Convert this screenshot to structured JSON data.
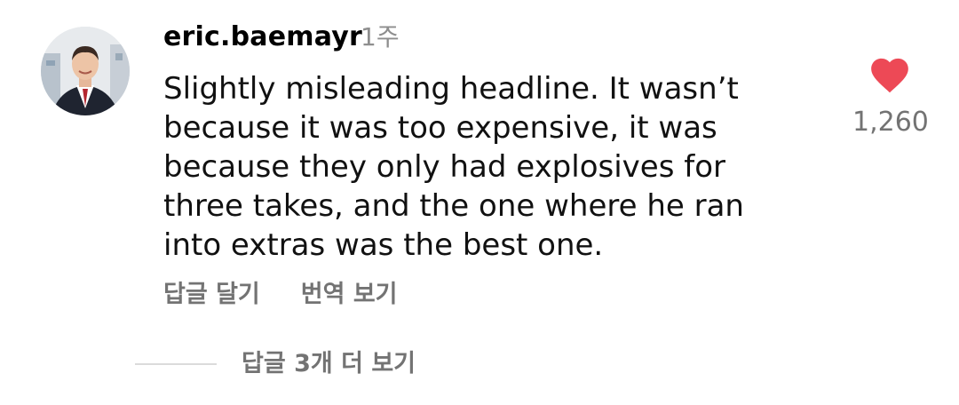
{
  "comment": {
    "username": "eric.baemayr",
    "time": "1주",
    "text_lines": [
      "Slightly misleading headline. It wasn’t",
      "because it was too expensive, it was",
      "because they only had explosives for",
      "three takes, and the one where he ran",
      "into extras was the best one."
    ],
    "actions": {
      "reply": "답글 달기",
      "translate": "번역 보기"
    },
    "like": {
      "icon": "heart-icon",
      "count": "1,260",
      "color": "#ed4956"
    },
    "view_replies": "답글 3개 더 보기"
  },
  "colors": {
    "secondary_text": "#737373",
    "timestamp": "#8e8e8e",
    "divider": "#dbdbdb"
  }
}
